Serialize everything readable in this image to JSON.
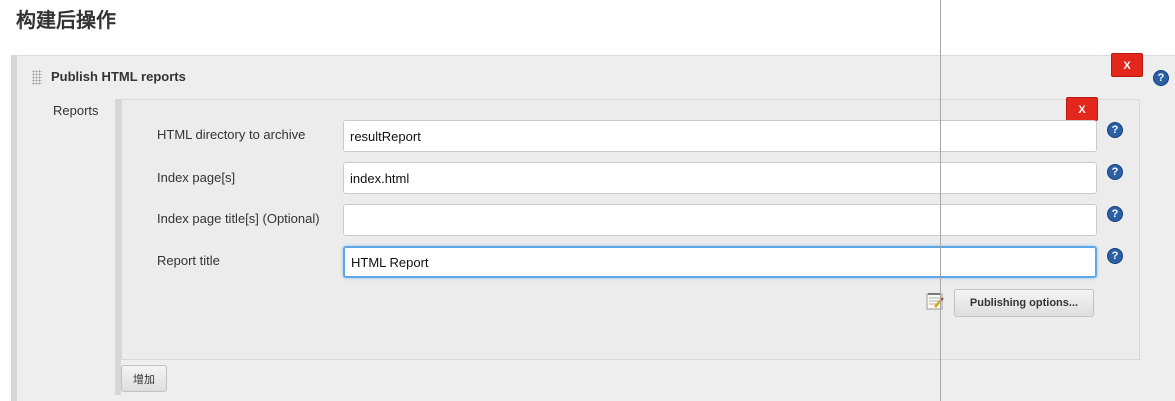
{
  "section": {
    "title": "构建后操作"
  },
  "publisher": {
    "title": "Publish HTML reports",
    "delete_label": "X",
    "help_glyph": "?",
    "reports_label": "Reports"
  },
  "report": {
    "delete_label": "X",
    "fields": [
      {
        "label": "HTML directory to archive",
        "value": "resultReport",
        "placeholder": ""
      },
      {
        "label": "Index page[s]",
        "value": "index.html",
        "placeholder": ""
      },
      {
        "label": "Index page title[s] (Optional)",
        "value": "",
        "placeholder": ""
      },
      {
        "label": "Report title",
        "value": "HTML Report",
        "placeholder": ""
      }
    ],
    "help_glyph": "?",
    "publishing_options_label": "Publishing options...",
    "notepad_icon": "notepad-icon"
  },
  "add_button_label": "增加",
  "colors": {
    "delete_red": "#e3271c",
    "help_blue": "#2b5fa6",
    "focus_blue": "#5fa6e8",
    "panel_gray": "#eeeeee"
  }
}
